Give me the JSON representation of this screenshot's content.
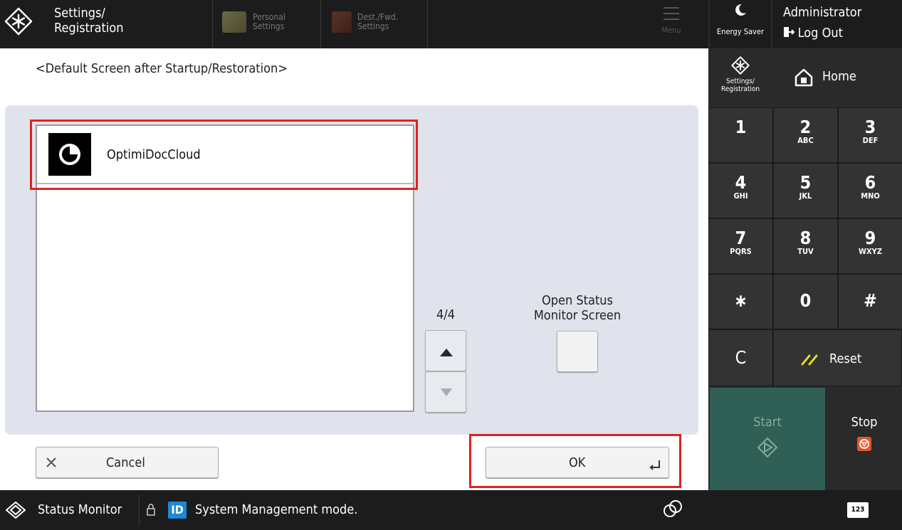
{
  "header": {
    "title_line1": "Settings/",
    "title_line2": "Registration",
    "tabs": [
      {
        "line1": "Personal",
        "line2": "Settings"
      },
      {
        "line1": "Dest./Fwd.",
        "line2": "Settings"
      }
    ],
    "menu_label": "Menu"
  },
  "right_panel": {
    "energy_saver": "Energy Saver",
    "user": "Administrator",
    "logout": "Log Out",
    "settings_line1": "Settings/",
    "settings_line2": "Registration",
    "home": "Home",
    "keys": [
      {
        "num": "1",
        "sub": ""
      },
      {
        "num": "2",
        "sub": "ABC"
      },
      {
        "num": "3",
        "sub": "DEF"
      },
      {
        "num": "4",
        "sub": "GHI"
      },
      {
        "num": "5",
        "sub": "JKL"
      },
      {
        "num": "6",
        "sub": "MNO"
      },
      {
        "num": "7",
        "sub": "PQRS"
      },
      {
        "num": "8",
        "sub": "TUV"
      },
      {
        "num": "9",
        "sub": "WXYZ"
      },
      {
        "num": "∗",
        "sub": ""
      },
      {
        "num": "0",
        "sub": ""
      },
      {
        "num": "#",
        "sub": ""
      }
    ],
    "clear": "C",
    "reset": "Reset",
    "start": "Start",
    "stop": "Stop",
    "keypad_label": "123"
  },
  "main": {
    "heading": "<Default Screen after Startup/Restoration>",
    "list_items": [
      "OptimiDocCloud"
    ],
    "page_indicator": "4/4",
    "open_status_line1": "Open Status",
    "open_status_line2": "Monitor Screen",
    "cancel": "Cancel",
    "ok": "OK"
  },
  "status_bar": {
    "status_monitor": "Status Monitor",
    "id_badge": "ID",
    "message": "System Management mode."
  },
  "colors": {
    "highlight_red": "#e02020",
    "start_green": "#2f5f55",
    "stop_orange": "#e8552a",
    "reset_yellow": "#e8d82a",
    "id_blue": "#1e88d8"
  }
}
